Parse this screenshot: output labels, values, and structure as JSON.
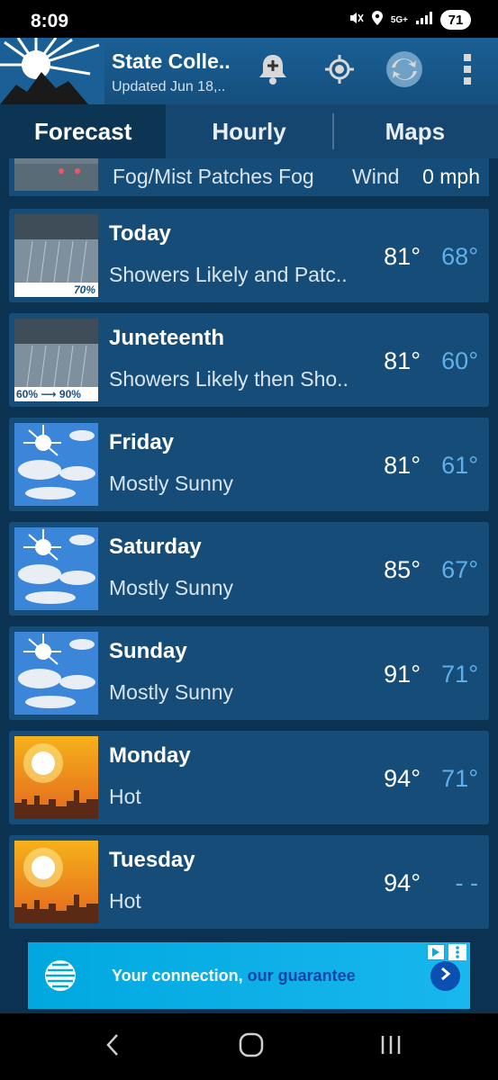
{
  "status_bar": {
    "time": "8:09",
    "network": "5G+",
    "battery": "71"
  },
  "header": {
    "title": "State Colle..",
    "subtitle": "Updated Jun 18,.."
  },
  "tabs": [
    {
      "label": "Forecast",
      "active": true
    },
    {
      "label": "Hourly",
      "active": false
    },
    {
      "label": "Maps",
      "active": false
    }
  ],
  "current": {
    "conditions": "Fog/Mist Patches Fog",
    "wind_label": "Wind",
    "wind_value": "0 mph"
  },
  "forecast": [
    {
      "day": "Today",
      "summary": "Showers Likely and Patc..",
      "high": "81°",
      "low": "68°",
      "icon": "rain-icon",
      "precip": "70%"
    },
    {
      "day": "Juneteenth",
      "summary": "Showers Likely then Sho..",
      "high": "81°",
      "low": "60°",
      "icon": "rain-icon",
      "precip": "60% ⟶ 90%"
    },
    {
      "day": "Friday",
      "summary": "Mostly Sunny",
      "high": "81°",
      "low": "61°",
      "icon": "mostly-sunny-icon"
    },
    {
      "day": "Saturday",
      "summary": "Mostly Sunny",
      "high": "85°",
      "low": "67°",
      "icon": "mostly-sunny-icon"
    },
    {
      "day": "Sunday",
      "summary": "Mostly Sunny",
      "high": "91°",
      "low": "71°",
      "icon": "mostly-sunny-icon"
    },
    {
      "day": "Monday",
      "summary": "Hot",
      "high": "94°",
      "low": "71°",
      "icon": "hot-icon"
    },
    {
      "day": "Tuesday",
      "summary": "Hot",
      "high": "94°",
      "low": "- -",
      "icon": "hot-icon"
    }
  ],
  "ad": {
    "text_part1": "Your connection,",
    "text_part2": " our guarantee"
  },
  "colors": {
    "card": "#164c78",
    "background": "#0b3250",
    "low_temp": "#5fb0ea",
    "header": "#1a5f95"
  }
}
